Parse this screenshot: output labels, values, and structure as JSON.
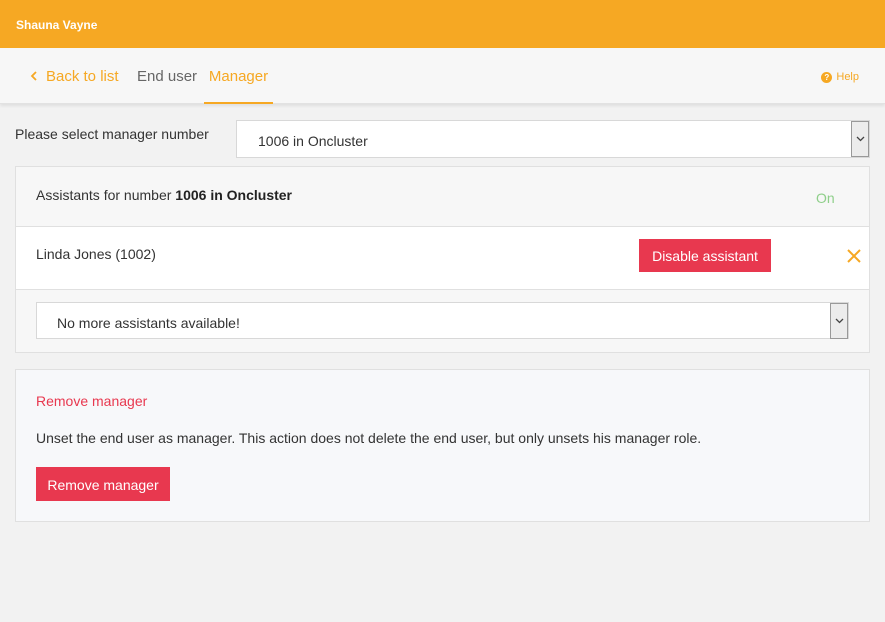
{
  "header": {
    "user_name": "Shauna Vayne"
  },
  "nav": {
    "back_label": "Back to list",
    "tabs": [
      {
        "label": "End user",
        "active": false
      },
      {
        "label": "Manager",
        "active": true
      }
    ],
    "help_label": "Help"
  },
  "manager_select": {
    "label": "Please select manager number",
    "selected": "1006 in Oncluster"
  },
  "assistants": {
    "title_prefix": "Assistants for number ",
    "number": "1006 in Oncluster",
    "status": "On",
    "items": [
      {
        "name": "Linda Jones (1002)",
        "action_label": "Disable assistant"
      }
    ],
    "add_select_value": "No more assistants available!"
  },
  "remove_manager": {
    "title": "Remove manager",
    "description": "Unset the end user as manager. This action does not delete the end user, but only unsets his manager role.",
    "button_label": "Remove manager"
  },
  "colors": {
    "accent": "#f6a823",
    "danger": "#e8384f",
    "status_on": "#8fcf8a"
  },
  "icons": [
    "chevron-left-icon",
    "help-icon",
    "chevron-down-icon",
    "close-icon"
  ]
}
